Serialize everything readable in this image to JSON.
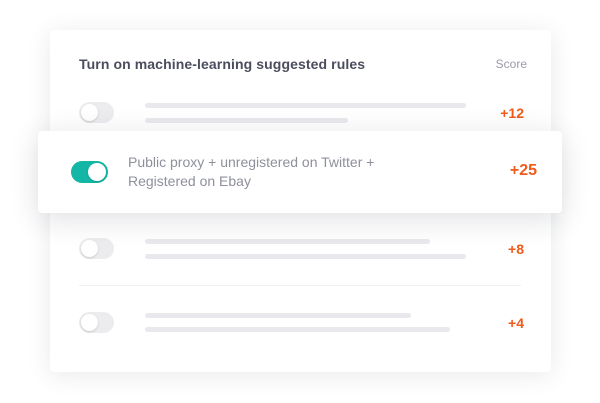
{
  "panel": {
    "title": "Turn on machine-learning suggested rules",
    "score_header": "Score"
  },
  "rules": [
    {
      "enabled": false,
      "score": "+12"
    },
    {
      "enabled": true,
      "text": "Public proxy + unregistered on Twitter + Registered on Ebay",
      "score": "+25"
    },
    {
      "enabled": false,
      "score": "+8"
    },
    {
      "enabled": false,
      "score": "+4"
    }
  ],
  "colors": {
    "accent_score": "#f05a1a",
    "toggle_on": "#14b6a6",
    "toggle_off": "#ececef",
    "placeholder_line": "#e9e9ed"
  }
}
